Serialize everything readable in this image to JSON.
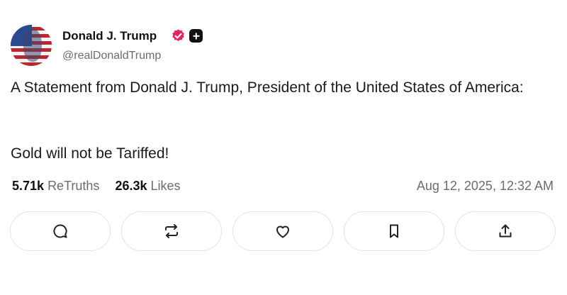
{
  "author": {
    "display_name": "Donald J. Trump",
    "handle": "@realDonaldTrump",
    "verified_badge_color": "#e0245e"
  },
  "post": {
    "text_line1": "A Statement from Donald J. Trump, President of the United States of America:",
    "text_line2": "Gold will not be Tariffed!"
  },
  "stats": {
    "retruths_count": "5.71k",
    "retruths_label": "ReTruths",
    "likes_count": "26.3k",
    "likes_label": "Likes"
  },
  "timestamp": "Aug 12, 2025, 12:32 AM",
  "actions": [
    {
      "icon": "reply-icon"
    },
    {
      "icon": "retruth-icon"
    },
    {
      "icon": "like-icon"
    },
    {
      "icon": "bookmark-icon"
    },
    {
      "icon": "share-icon"
    }
  ]
}
